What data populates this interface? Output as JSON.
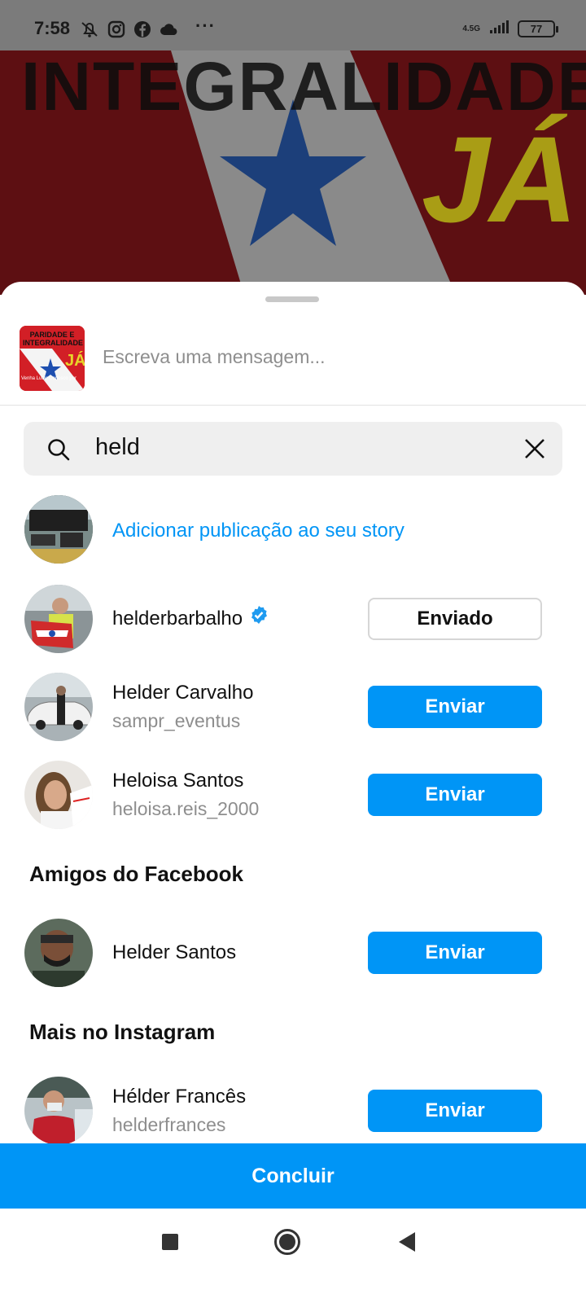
{
  "status_bar": {
    "time": "7:58",
    "network": "4.5G",
    "battery": "77"
  },
  "backdrop": {
    "headline": "INTEGRALIDADE",
    "highlight": "JÁ"
  },
  "share_sheet": {
    "post_thumbnail": {
      "line1": "PARIDADE E",
      "line2": "INTEGRALIDADE",
      "line3": "JÁ",
      "line4": "Venha Lutar Conosco por"
    },
    "message_placeholder": "Escreva uma mensagem...",
    "search": {
      "query": "held"
    },
    "story": {
      "label": "Adicionar publicação ao seu story"
    },
    "results": [
      {
        "name": "helderbarbalho",
        "username": "",
        "verified": true,
        "action": "Enviado"
      },
      {
        "name": "Helder Carvalho",
        "username": "sampr_eventus",
        "verified": false,
        "action": "Enviar"
      },
      {
        "name": "Heloisa Santos",
        "username": "heloisa.reis_2000",
        "verified": false,
        "action": "Enviar"
      }
    ],
    "facebook_section": {
      "title": "Amigos do Facebook",
      "items": [
        {
          "name": "Helder Santos",
          "action": "Enviar"
        }
      ]
    },
    "instagram_section": {
      "title": "Mais no Instagram",
      "items": [
        {
          "name": "Hélder Francês",
          "username": "helderfrances",
          "action": "Enviar"
        }
      ]
    },
    "done_label": "Concluir"
  },
  "colors": {
    "accent": "#0095f6",
    "muted_text": "#8e8e8e",
    "status_bar_bg": "#7b7b7b"
  },
  "icons": {
    "status_left": [
      "mute-icon",
      "instagram-icon",
      "facebook-icon",
      "cloud-icon"
    ],
    "status_right": [
      "signal-icon",
      "battery-icon"
    ],
    "nav": [
      "recents-square-icon",
      "home-circle-icon",
      "back-triangle-icon"
    ]
  }
}
